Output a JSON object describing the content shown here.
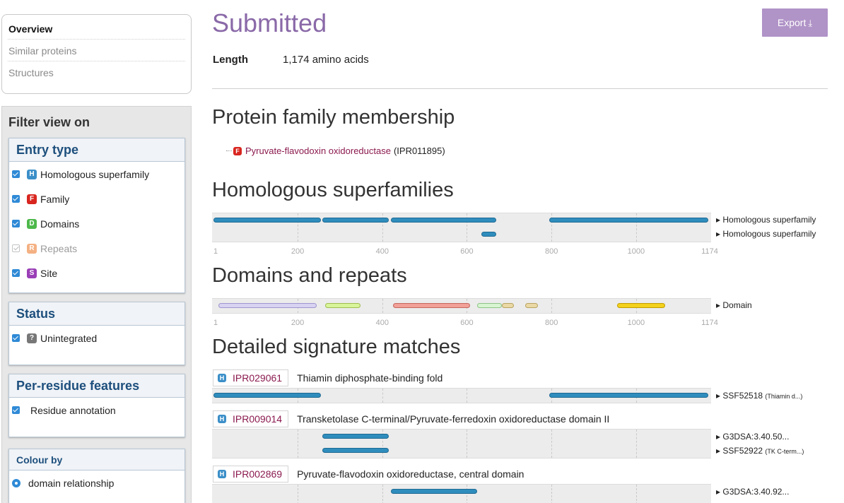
{
  "nav": {
    "items": [
      {
        "label": "Overview",
        "active": true
      },
      {
        "label": "Similar proteins",
        "active": false
      },
      {
        "label": "Structures",
        "active": false
      }
    ]
  },
  "filter": {
    "title": "Filter view on",
    "entry_type": {
      "heading": "Entry type",
      "items": [
        {
          "badge": "H",
          "label": "Homologous superfamily",
          "checked": true,
          "color": "#3b8fc8"
        },
        {
          "badge": "F",
          "label": "Family",
          "checked": true,
          "color": "#d8261f"
        },
        {
          "badge": "D",
          "label": "Domains",
          "checked": true,
          "color": "#4db84a"
        },
        {
          "badge": "R",
          "label": "Repeats",
          "checked": false,
          "color": "#f4b183"
        },
        {
          "badge": "S",
          "label": "Site",
          "checked": true,
          "color": "#9a3fb6"
        }
      ]
    },
    "status": {
      "heading": "Status",
      "items": [
        {
          "badge": "?",
          "label": "Unintegrated",
          "checked": true,
          "color": "#777777"
        }
      ]
    },
    "per_residue": {
      "heading": "Per-residue features",
      "items": [
        {
          "label": "Residue annotation",
          "checked": true
        }
      ]
    },
    "colour_by": {
      "heading": "Colour by",
      "items": [
        {
          "label": "domain relationship",
          "selected": true
        }
      ]
    }
  },
  "main": {
    "title": "Submitted",
    "export_label": "Export",
    "length_label": "Length",
    "length_value": "1,174 amino acids",
    "sections": {
      "family": "Protein family membership",
      "homologous": "Homologous superfamilies",
      "domains": "Domains and repeats",
      "signatures": "Detailed signature matches"
    },
    "family_entry": {
      "badge": "F",
      "name": "Pyruvate-flavodoxin oxidoreductase",
      "accession": "(IPR011895)"
    },
    "axis": {
      "max": 1174,
      "ticks": [
        "1",
        "200",
        "400",
        "600",
        "800",
        "1000",
        "1174"
      ]
    },
    "homologous_tracks": [
      {
        "label": "▸ Homologous superfamily",
        "segments": [
          [
            1,
            255
          ],
          [
            258,
            415
          ],
          [
            420,
            670
          ],
          [
            795,
            1170
          ]
        ]
      },
      {
        "label": "▸ Homologous superfamily",
        "segments": [
          [
            635,
            670
          ]
        ]
      }
    ],
    "domain_track": {
      "label": "▸ Domain",
      "segments": [
        {
          "range": [
            12,
            245
          ],
          "color": "#d9d3f2",
          "border": "#9f95cf"
        },
        {
          "range": [
            265,
            348
          ],
          "color": "#d9f59a",
          "border": "#9dbd4f"
        },
        {
          "range": [
            425,
            608
          ],
          "color": "#f2a198",
          "border": "#c5675e"
        },
        {
          "range": [
            625,
            683
          ],
          "color": "#d8f5d2",
          "border": "#8fc387"
        },
        {
          "range": [
            683,
            712
          ],
          "color": "#ead9a4",
          "border": "#b8a362"
        },
        {
          "range": [
            738,
            768
          ],
          "color": "#ead9a4",
          "border": "#b8a362"
        },
        {
          "range": [
            955,
            1068
          ],
          "color": "#f4d11c",
          "border": "#c09d00"
        }
      ]
    },
    "signatures": [
      {
        "badge": "H",
        "accession": "IPR029061",
        "name": "Thiamin diphosphate-binding fold",
        "tracks": [
          {
            "label": "▸ SSF52518",
            "detail": "(Thiamin d...)",
            "segments": [
              [
                1,
                255
              ],
              [
                795,
                1170
              ]
            ]
          }
        ]
      },
      {
        "badge": "H",
        "accession": "IPR009014",
        "name": "Transketolase C-terminal/Pyruvate-ferredoxin oxidoreductase domain II",
        "tracks": [
          {
            "label": "▸ G3DSA:3.40.50...",
            "detail": "",
            "segments": [
              [
                258,
                415
              ]
            ]
          },
          {
            "label": "▸ SSF52922",
            "detail": "(TK C-term...)",
            "segments": [
              [
                258,
                415
              ]
            ]
          }
        ]
      },
      {
        "badge": "H",
        "accession": "IPR002869",
        "name": "Pyruvate-flavodoxin oxidoreductase, central domain",
        "tracks": [
          {
            "label": "▸ G3DSA:3.40.92...",
            "detail": "",
            "segments": [
              [
                420,
                625
              ]
            ]
          }
        ]
      }
    ]
  },
  "colors": {
    "accent": "#8a69a8",
    "button": "#b093c7",
    "link": "#8b1a4f",
    "track_blue": "#2f8dbd"
  }
}
